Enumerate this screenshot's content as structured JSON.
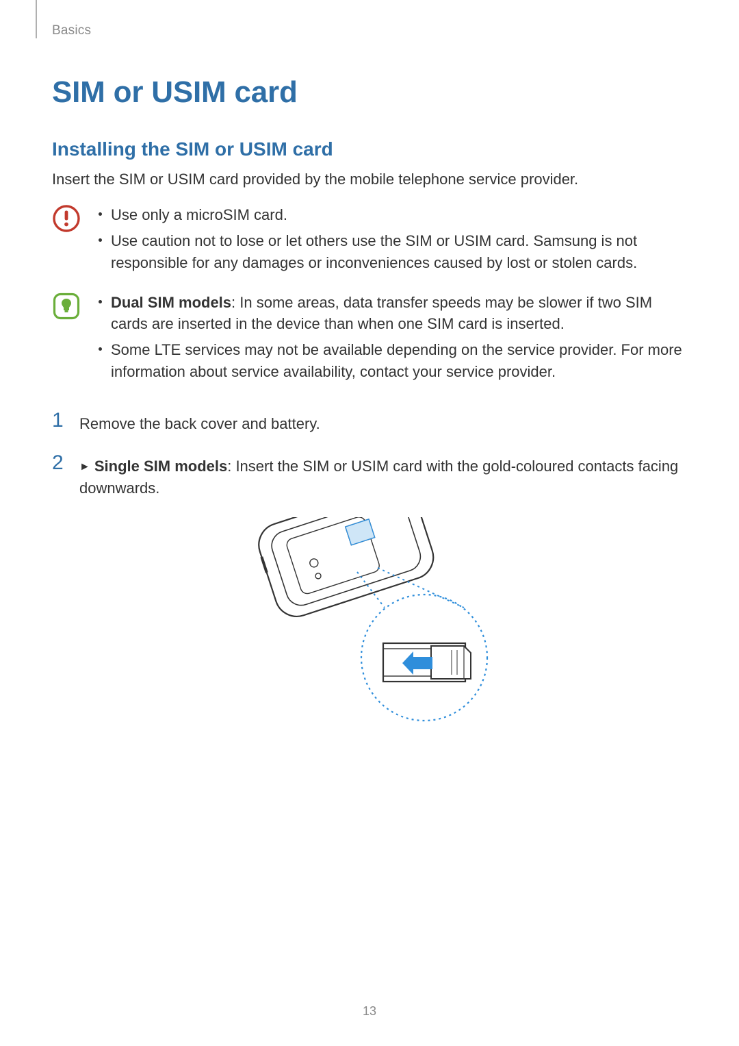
{
  "breadcrumb": "Basics",
  "title": "SIM or USIM card",
  "subtitle": "Installing the SIM or USIM card",
  "intro": "Insert the SIM or USIM card provided by the mobile telephone service provider.",
  "caution": {
    "icon_name": "caution-icon",
    "items": [
      {
        "text": "Use only a microSIM card."
      },
      {
        "text": "Use caution not to lose or let others use the SIM or USIM card. Samsung is not responsible for any damages or inconveniences caused by lost or stolen cards."
      }
    ]
  },
  "note": {
    "icon_name": "note-icon",
    "items": [
      {
        "bold": "Dual SIM models",
        "text": ": In some areas, data transfer speeds may be slower if two SIM cards are inserted in the device than when one SIM card is inserted."
      },
      {
        "text": "Some LTE services may not be available depending on the service provider. For more information about service availability, contact your service provider."
      }
    ]
  },
  "steps": [
    {
      "num": "1",
      "text": "Remove the back cover and battery."
    },
    {
      "num": "2",
      "triangle": "►",
      "bold": "Single SIM models",
      "text": ": Insert the SIM or USIM card with the gold-coloured contacts facing downwards."
    }
  ],
  "page_number": "13",
  "colors": {
    "heading": "#2F6FA7",
    "caution_stroke": "#C23A2D",
    "note_stroke": "#6AAE3A",
    "note_fill": "#6AAE3A",
    "diagram_accent": "#2F8EDB"
  }
}
